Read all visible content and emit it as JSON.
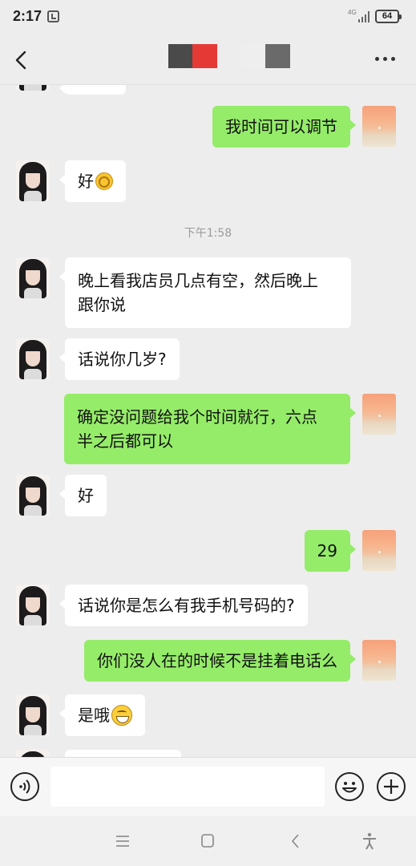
{
  "status_bar": {
    "time": "2:17",
    "network": "4G",
    "battery": "64"
  },
  "header": {
    "title_redacted": true,
    "redaction_colors": [
      "#4a4a4a",
      "#e53935",
      "#eeeeee",
      "#666666"
    ],
    "back_icon": "chevron-left-icon",
    "more_icon": "more-dots-icon"
  },
  "messages": [
    {
      "side": "her",
      "text": "我时间可以调节",
      "partial": true
    },
    {
      "side": "me",
      "text": "我时间可以调节"
    },
    {
      "side": "her",
      "text": "好",
      "emoji": "ok-hand"
    },
    {
      "type": "timestamp",
      "text": "下午1:58"
    },
    {
      "side": "her",
      "lines": [
        "晚上看我店员几点有空，然后晚上",
        "跟你说"
      ]
    },
    {
      "side": "her",
      "text": "话说你几岁?"
    },
    {
      "side": "me",
      "lines": [
        "确定没问题给我个时间就行，六点",
        "半之后都可以"
      ]
    },
    {
      "side": "her",
      "text": "好"
    },
    {
      "side": "me",
      "text": "29"
    },
    {
      "side": "her",
      "text": "话说你是怎么有我手机号码的?"
    },
    {
      "side": "me",
      "text": "你们没人在的时候不是挂着电话么"
    },
    {
      "side": "her",
      "text": "是哦",
      "emoji": "grin"
    }
  ],
  "input": {
    "placeholder": "",
    "voice_icon": "voice-icon",
    "emoji_icon": "emoji-icon",
    "plus_icon": "plus-icon"
  },
  "colors": {
    "bg": "#ededed",
    "bubble_me": "#95ec69",
    "bubble_her": "#ffffff",
    "timestamp": "#9b9b9b"
  },
  "system_nav": {
    "icons": [
      "menu-icon",
      "home-icon",
      "back-icon",
      "accessibility-icon"
    ]
  }
}
